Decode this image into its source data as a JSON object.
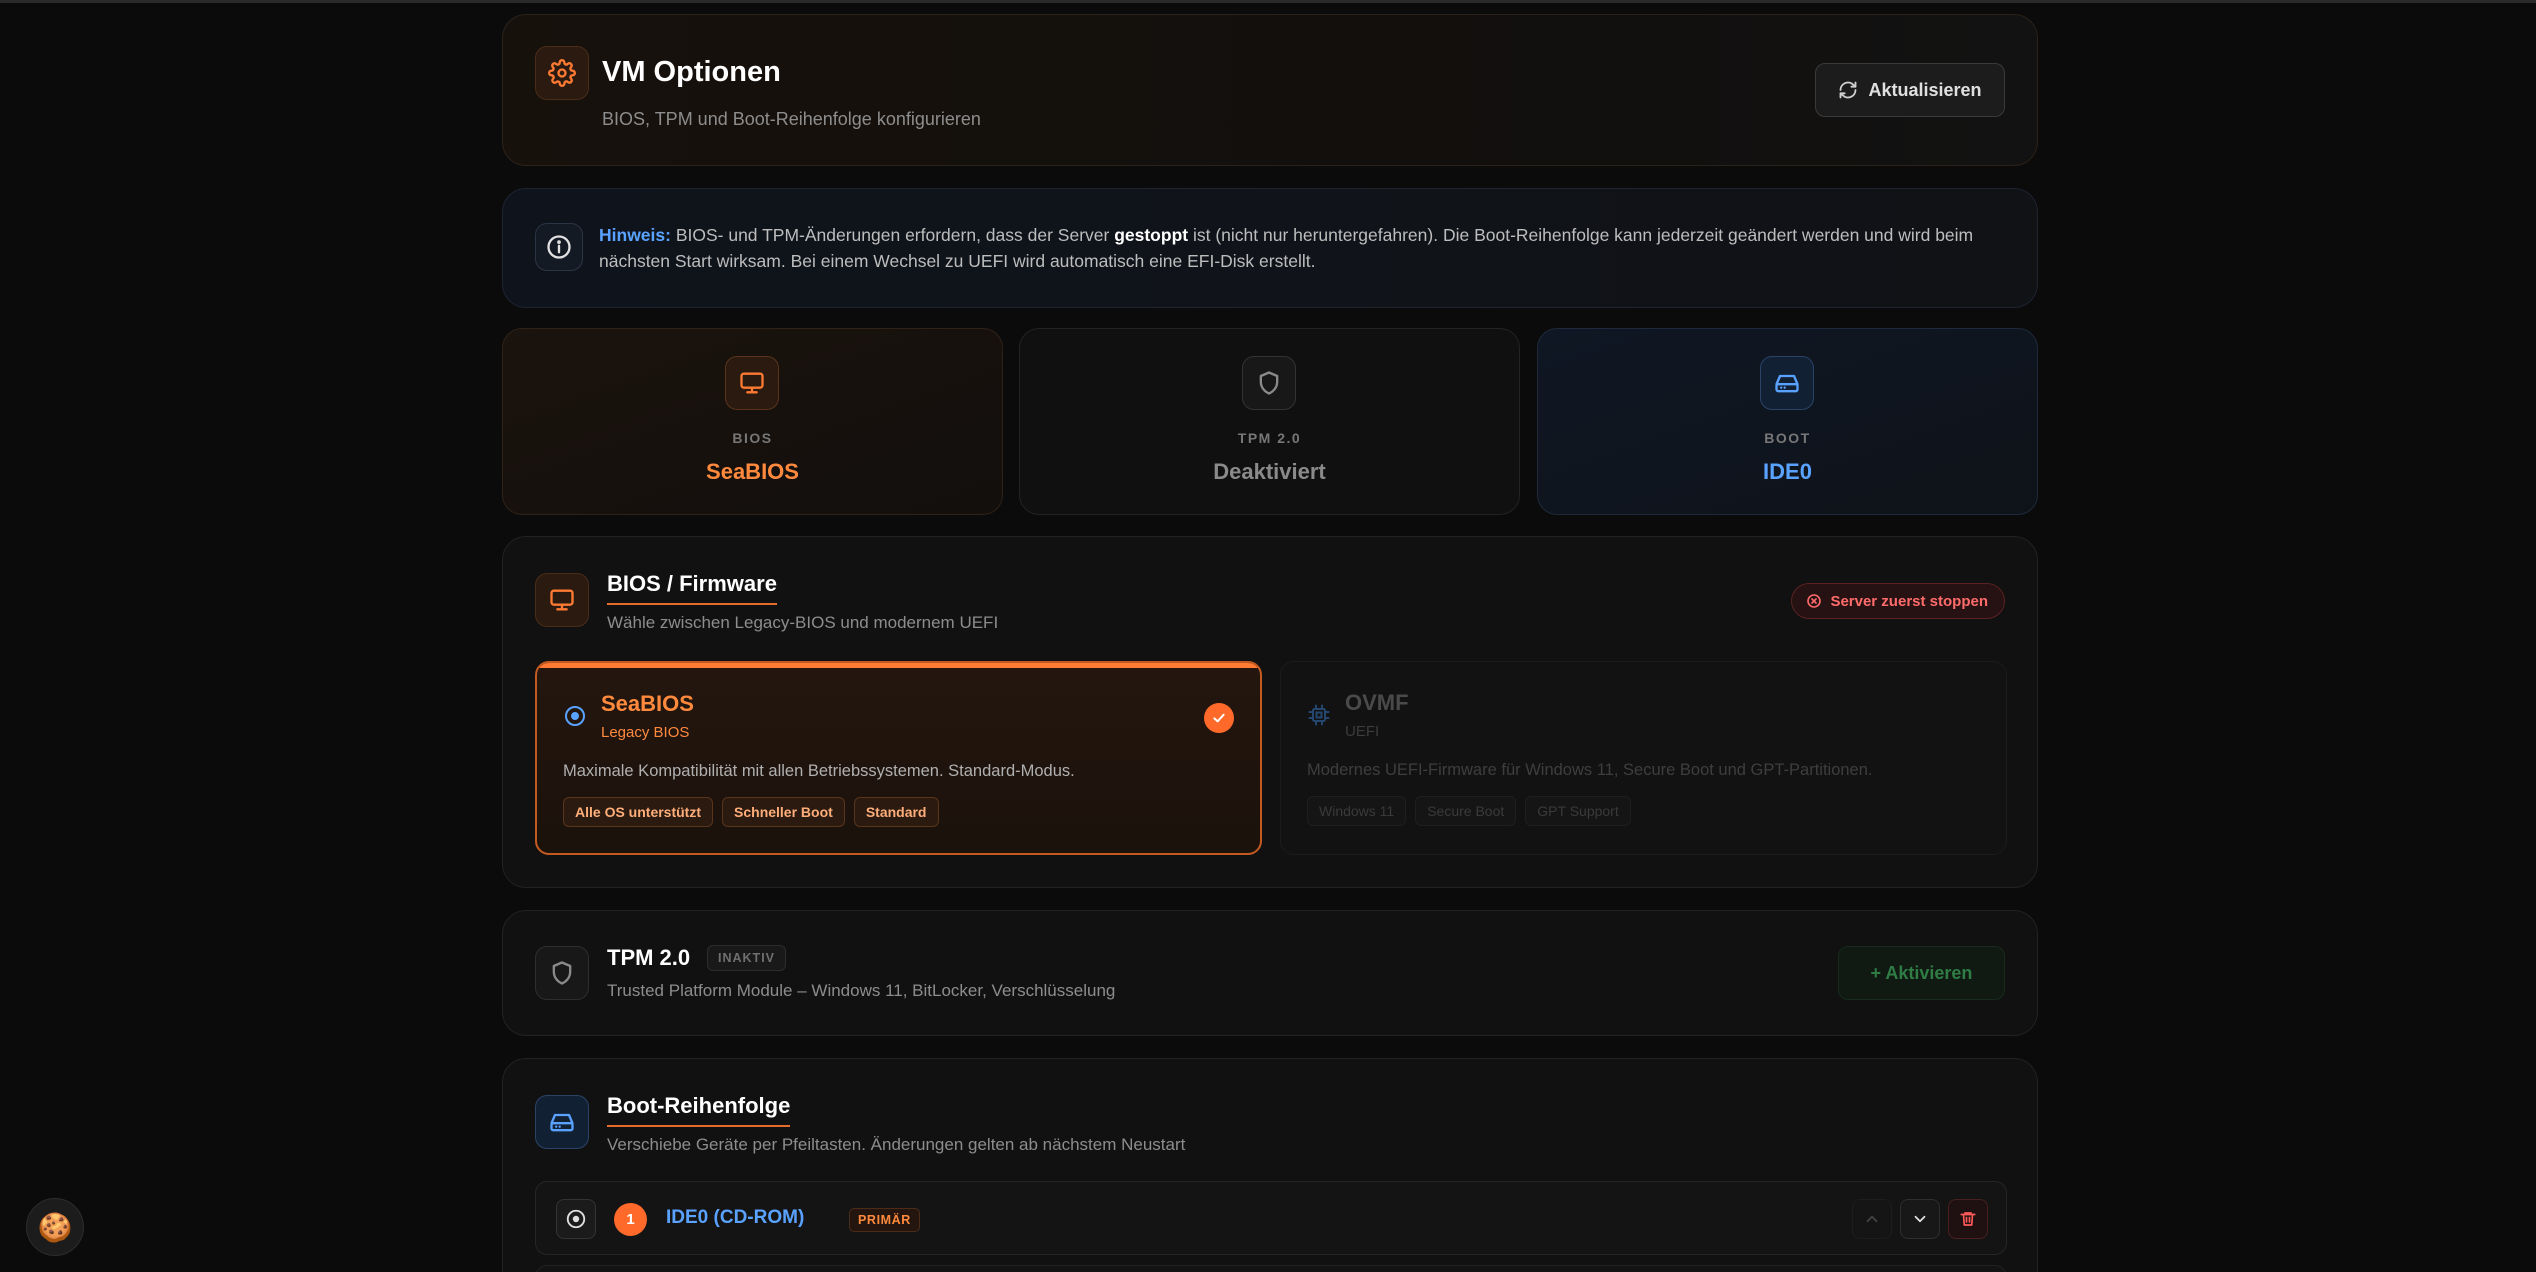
{
  "header": {
    "title": "VM Optionen",
    "subtitle": "BIOS, TPM und Boot-Reihenfolge konfigurieren",
    "refresh_label": "Aktualisieren"
  },
  "note": {
    "label": "Hinweis:",
    "text_1": " BIOS- und TPM-Änderungen erfordern, dass der Server ",
    "bold": "gestoppt",
    "text_2": " ist (nicht nur heruntergefahren). Die Boot-Reihenfolge kann jederzeit geändert werden und wird beim nächsten Start wirksam. Bei einem Wechsel zu UEFI wird automatisch eine EFI-Disk erstellt."
  },
  "status": {
    "bios": {
      "label": "BIOS",
      "value": "SeaBIOS"
    },
    "tpm": {
      "label": "TPM 2.0",
      "value": "Deaktiviert"
    },
    "boot": {
      "label": "BOOT",
      "value": "IDE0"
    }
  },
  "bios_section": {
    "title": "BIOS / Firmware",
    "subtitle": "Wähle zwischen Legacy-BIOS und modernem UEFI",
    "stop_badge": "Server zuerst stoppen",
    "options": [
      {
        "name": "SeaBIOS",
        "type": "Legacy BIOS",
        "description": "Maximale Kompatibilität mit allen Betriebssystemen. Standard-Modus.",
        "tags": [
          "Alle OS unterstützt",
          "Schneller Boot",
          "Standard"
        ],
        "selected": true
      },
      {
        "name": "OVMF",
        "type": "UEFI",
        "description": "Modernes UEFI-Firmware für Windows 11, Secure Boot und GPT-Partitionen.",
        "tags": [
          "Windows 11",
          "Secure Boot",
          "GPT Support"
        ],
        "selected": false
      }
    ]
  },
  "tpm_section": {
    "title": "TPM 2.0",
    "badge": "INAKTIV",
    "subtitle": "Trusted Platform Module – Windows 11, BitLocker, Verschlüsselung",
    "activate_label": "+ Aktivieren"
  },
  "boot_section": {
    "title": "Boot-Reihenfolge",
    "subtitle": "Verschiebe Geräte per Pfeiltasten. Änderungen gelten ab nächstem Neustart",
    "devices": [
      {
        "position": "1",
        "name": "IDE0 (CD-ROM)",
        "badge": "PRIMÄR"
      }
    ]
  },
  "colors": {
    "accent_orange": "#ff7a33",
    "accent_blue": "#5aa2ff",
    "danger_red": "#ff6b6b",
    "success_green": "#2f7d45",
    "background": "#0b0b0b"
  }
}
